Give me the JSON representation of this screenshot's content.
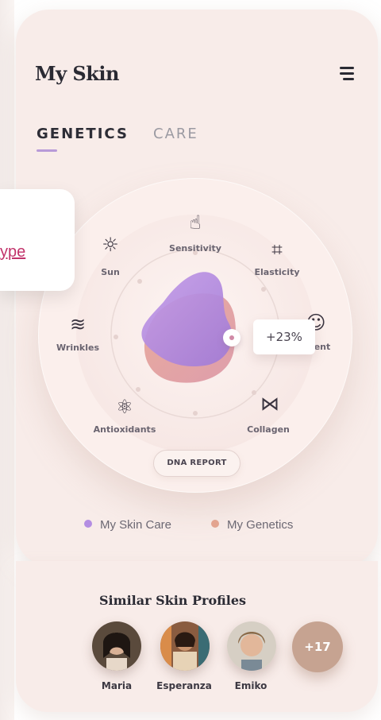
{
  "header": {
    "title": "My Skin",
    "menu_icon": "hamburger-menu-icon"
  },
  "tabs": [
    {
      "label": "GENETICS",
      "active": true
    },
    {
      "label": "CARE",
      "active": false
    }
  ],
  "floating_card": {
    "link_text": "ype"
  },
  "dial": {
    "categories": [
      {
        "label": "Sensitivity",
        "icon": "pointer-hand-icon"
      },
      {
        "label": "Elasticity",
        "icon": "stretch-square-icon"
      },
      {
        "label": "ent",
        "icon": "face-profile-icon"
      },
      {
        "label": "Collagen",
        "icon": "collagen-mesh-icon"
      },
      {
        "label": "Antioxidants",
        "icon": "molecule-cluster-icon"
      },
      {
        "label": "Wrinkles",
        "icon": "waves-icon"
      },
      {
        "label": "Sun",
        "icon": "sun-icon"
      }
    ],
    "highlight_value": "+23%",
    "report_button": "DNA REPORT"
  },
  "legend": [
    {
      "label": "My Skin Care",
      "color": "#b48de2"
    },
    {
      "label": "My Genetics",
      "color": "#e3a48f"
    }
  ],
  "similar_profiles": {
    "title": "Similar Skin Profiles",
    "people": [
      {
        "name": "Maria"
      },
      {
        "name": "Esperanza"
      },
      {
        "name": "Emiko"
      }
    ],
    "more_count": "+17"
  },
  "colors": {
    "background_card": "#f8ece9",
    "accent_purple": "#b48de2",
    "accent_peach": "#e3a48f",
    "link": "#c2336b"
  }
}
